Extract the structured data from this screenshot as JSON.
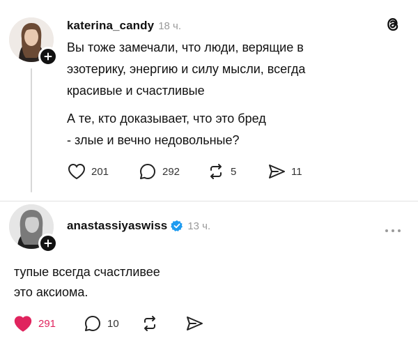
{
  "post1": {
    "username": "katerina_candy",
    "time": "18 ч.",
    "text1": "Вы тоже замечали, что люди, верящие в\nэзотерику, энергию и силу мысли, всегда\nкрасивые и счастливые",
    "text2": "А те, кто доказывает, что это бред\n- злые и вечно недовольные?",
    "likes": "201",
    "replies": "292",
    "reposts": "5",
    "shares": "11"
  },
  "post2": {
    "username": "anastassiyaswiss",
    "verified": true,
    "time": "13 ч.",
    "text": "тупые всегда счастливее\nэто аксиома.",
    "likes": "291",
    "liked": true,
    "replies": "10"
  },
  "colors": {
    "like_active": "#e0245e",
    "verified": "#1d9bf0",
    "muted": "#9a9a9a"
  },
  "icons": [
    "threads-logo-icon",
    "plus-icon",
    "heart-icon",
    "comment-icon",
    "repost-icon",
    "share-icon",
    "verified-badge-icon",
    "more-icon"
  ]
}
